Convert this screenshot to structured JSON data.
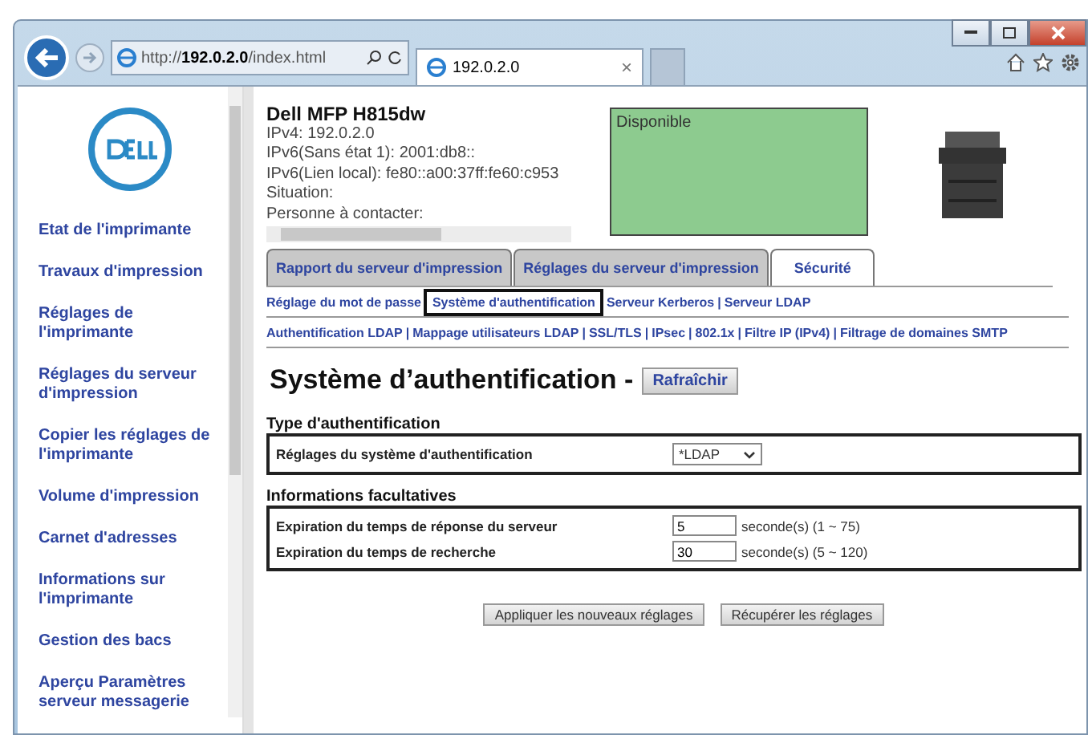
{
  "browser": {
    "address": {
      "prefix": "http://",
      "host": "192.0.2.0",
      "path": "/index.html"
    },
    "tab": {
      "title": "192.0.2.0",
      "close": "×"
    }
  },
  "sidebar": {
    "items": [
      {
        "label": "Etat de l'imprimante"
      },
      {
        "label": "Travaux d'impression"
      },
      {
        "label": "Réglages de l'imprimante"
      },
      {
        "label": "Réglages du serveur d'impression"
      },
      {
        "label": "Copier les réglages de l'imprimante"
      },
      {
        "label": "Volume d'impression"
      },
      {
        "label": "Carnet d'adresses"
      },
      {
        "label": "Informations sur l'imprimante"
      },
      {
        "label": "Gestion des bacs"
      },
      {
        "label": "Aperçu Paramètres serveur messagerie"
      }
    ]
  },
  "device": {
    "name": "Dell MFP H815dw",
    "lines": [
      "IPv4: 192.0.2.0",
      "IPv6(Sans état 1): 2001:db8::",
      "IPv6(Lien local): fe80::a00:37ff:fe60:c953",
      "Situation:",
      "Personne à contacter:"
    ],
    "status": "Disponible"
  },
  "tabs": [
    {
      "label": "Rapport du serveur d'impression",
      "selected": false
    },
    {
      "label": "Réglages du serveur d'impression",
      "selected": false
    },
    {
      "label": "Sécurité",
      "selected": true
    }
  ],
  "subnav": {
    "separator": "|",
    "lines": [
      {
        "links": [
          {
            "label": "Réglage du mot de passe",
            "selected": false
          },
          {
            "label": "Système d'authentification",
            "selected": true
          },
          {
            "label": "Serveur Kerberos",
            "selected": false
          },
          {
            "label": "Serveur LDAP",
            "selected": false
          }
        ]
      },
      {
        "links": [
          {
            "label": "Authentification LDAP",
            "selected": false
          },
          {
            "label": "Mappage utilisateurs LDAP",
            "selected": false
          },
          {
            "label": "SSL/TLS",
            "selected": false
          },
          {
            "label": "IPsec",
            "selected": false
          },
          {
            "label": "802.1x",
            "selected": false
          },
          {
            "label": "Filtre IP (IPv4)",
            "selected": false
          },
          {
            "label": "Filtrage de domaines SMTP",
            "selected": false
          }
        ]
      }
    ]
  },
  "page": {
    "title": "Système d’authentification -",
    "refresh": "Rafraîchir"
  },
  "sections": [
    {
      "title": "Type d'authentification",
      "rows": [
        {
          "kind": "select",
          "label": "Réglages du système d'authentification",
          "value": "*LDAP"
        }
      ]
    },
    {
      "title": "Informations facultatives",
      "rows": [
        {
          "kind": "number",
          "label": "Expiration du temps de réponse du serveur",
          "value": "5",
          "unit": "seconde(s) (1 ~ 75)"
        },
        {
          "kind": "number",
          "label": "Expiration du temps de recherche",
          "value": "30",
          "unit": "seconde(s) (5 ~ 120)"
        }
      ]
    }
  ],
  "buttons": [
    "Appliquer les nouveaux réglages",
    "Récupérer les réglages"
  ]
}
